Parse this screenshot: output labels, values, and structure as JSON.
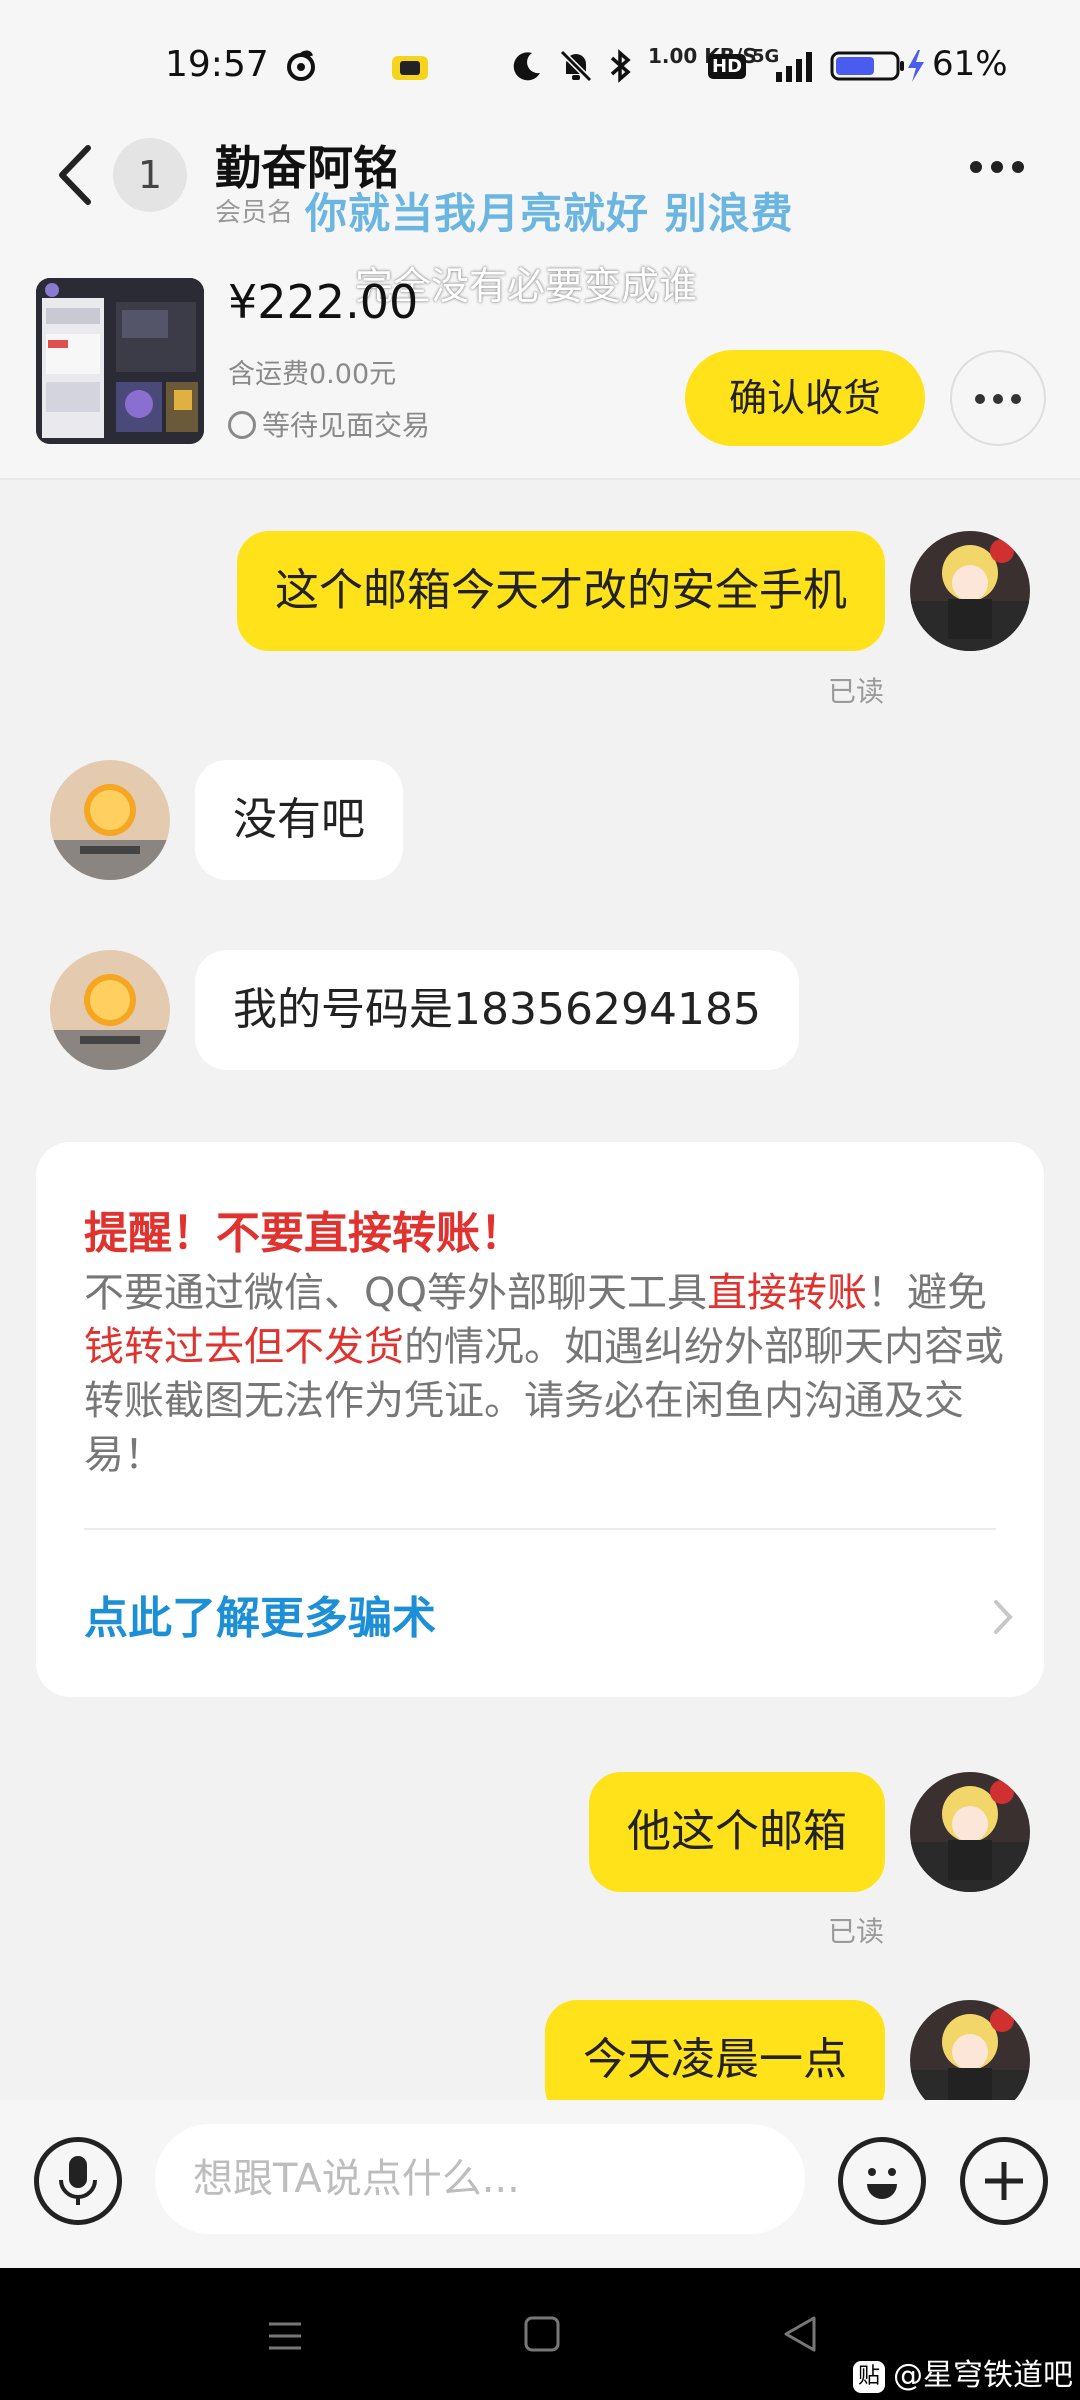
{
  "status_bar": {
    "time": "19:57",
    "net_speed": "1.00 KB/S",
    "network": "5G",
    "hd": "HD",
    "battery": "61%"
  },
  "header": {
    "unread_count": "1",
    "contact_name": "勤奋阿铭",
    "member_prefix": "会员名",
    "overlay_lyric_1": "你就当我月亮就好 别浪费",
    "overlay_lyric_2": "完全没有必要变成谁"
  },
  "item": {
    "price": "¥222.00",
    "shipping": "含运费0.00元",
    "status": "等待见面交易",
    "confirm_label": "确认收货"
  },
  "messages": [
    {
      "side": "out",
      "text": "这个邮箱今天才改的安全手机",
      "status": "已读"
    },
    {
      "side": "in",
      "text": "没有吧"
    },
    {
      "side": "in",
      "text": "我的号码是18356294185"
    },
    {
      "side": "out",
      "text": "他这个邮箱",
      "status": "已读"
    },
    {
      "side": "out",
      "text": "今天凌晨一点"
    }
  ],
  "warning": {
    "title": "提醒！不要直接转账！",
    "body_1": "不要通过微信、QQ等外部聊天工具",
    "body_hl_1": "直接转账",
    "body_2": "！避免",
    "body_hl_2": "钱转过去但不发货",
    "body_3": "的情况。如遇纠纷外部聊天内容或转账截图无法作为凭证。请务必在闲鱼内沟通及交易！",
    "link": "点此了解更多骗术"
  },
  "input": {
    "placeholder": "想跟TA说点什么..."
  },
  "watermark": {
    "badge": "贴",
    "text": "@星穹铁道吧"
  },
  "colors": {
    "accent_yellow": "#ffe21a",
    "warning_red": "#e0322e",
    "link_blue": "#1c8fd6"
  }
}
